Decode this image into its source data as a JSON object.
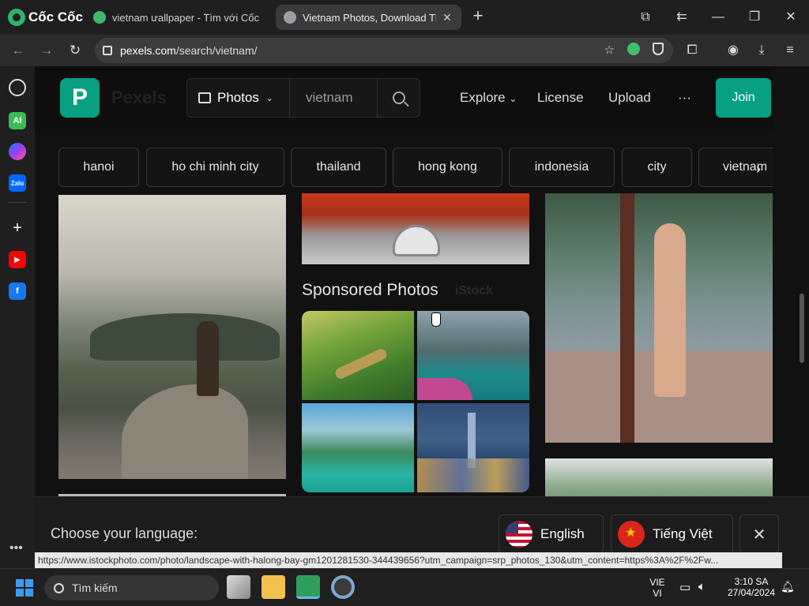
{
  "browser": {
    "brand": "Cốc Cốc",
    "tabs": [
      {
        "title": "vietnam ưallpaper - Tìm với Cốc Cốc"
      },
      {
        "title": "Vietnam Photos, Download The BEST Free Vietnam Stock Photos"
      }
    ],
    "url_host": "pexels.com",
    "url_path": "/search/vietnam/",
    "status_url": "https://www.istockphoto.com/photo/landscape-with-halong-bay-gm1201281530-344439656?utm_campaign=srp_photos_130&utm_content=https%3A%2F%2Fw..."
  },
  "site": {
    "logo_letter": "P",
    "name": "Pexels",
    "search_type": "Photos",
    "search_value": "vietnam",
    "nav": {
      "explore": "Explore",
      "license": "License",
      "upload": "Upload",
      "more": "···"
    },
    "join_label": "Join",
    "chips": [
      "hanoi",
      "ho chi minh city",
      "thailand",
      "hong kong",
      "indonesia",
      "city",
      "vietnam"
    ],
    "sponsored_title": "Sponsored Photos",
    "sponsored_brand": "iStock"
  },
  "language_banner": {
    "title": "Choose your language:",
    "english": "English",
    "vietnamese": "Tiếng Việt",
    "close": "✕"
  },
  "taskbar": {
    "search_placeholder": "Tìm kiếm",
    "lang_top": "VIE",
    "lang_bottom": "VI",
    "time": "3:10 SA",
    "date": "27/04/2024"
  }
}
